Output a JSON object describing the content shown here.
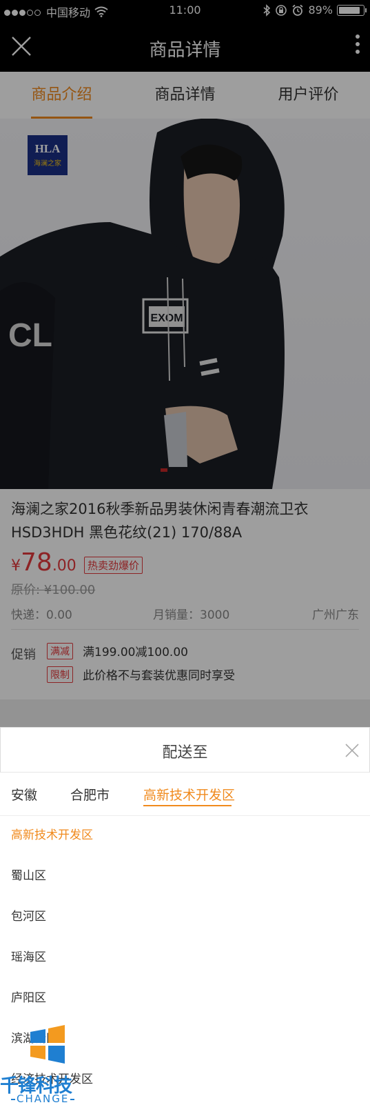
{
  "status_bar": {
    "carrier": "中国移动",
    "time": "11:00",
    "battery": "89%"
  },
  "nav": {
    "title": "商品详情"
  },
  "tabs": [
    {
      "label": "商品介绍",
      "active": true
    },
    {
      "label": "商品详情",
      "active": false
    },
    {
      "label": "用户评价",
      "active": false
    }
  ],
  "product": {
    "brand_logo": {
      "line1": "HLA",
      "line2": "海澜之家"
    },
    "hoodie_print": "EXOM",
    "sleeve_print": "CL",
    "title": "海澜之家2016秋季新品男装休闲青春潮流卫衣HSD3HDH 黑色花纹(21) 170/88A",
    "price": {
      "currency": "¥",
      "integer": "78",
      "decimal": ".00"
    },
    "price_tag": "热卖劲爆价",
    "original_price": "原价: ¥100.00",
    "express": "快递：0.00",
    "monthly_sales": "月销量：3000",
    "location": "广州广东",
    "promotion": {
      "label": "促销",
      "items": [
        {
          "tag": "满减",
          "text": "满199.00减100.00"
        },
        {
          "tag": "限制",
          "text": "此价格不与套装优惠同时享受"
        }
      ]
    }
  },
  "delivery_sheet": {
    "title": "配送至",
    "region_tabs": [
      "安徽",
      "合肥市",
      "高新技术开发区"
    ],
    "active_region_tab": 2,
    "districts": [
      "高新技术开发区",
      "蜀山区",
      "包河区",
      "瑶海区",
      "庐阳区",
      "滨湖新区",
      "经济技术开发区"
    ],
    "selected_district": 0
  },
  "watermark": {
    "name": "千锋科技",
    "sub": "CHANGE"
  },
  "colors": {
    "accent": "#f08a1d",
    "price_red": "#e4393c",
    "nav_bg": "#000000",
    "hoodie": "#1b1d24",
    "watermark_blue": "#1f7fd1"
  }
}
